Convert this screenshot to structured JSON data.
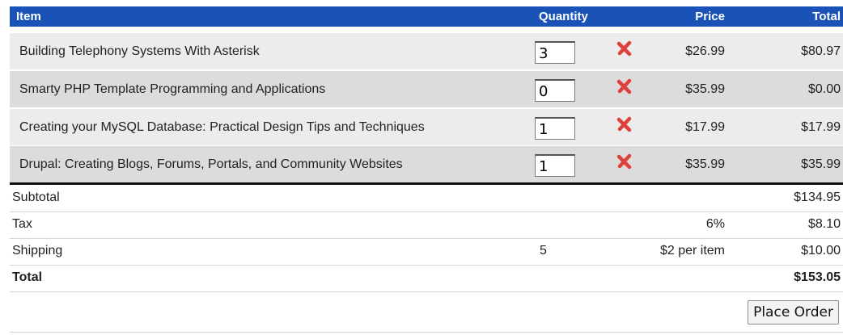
{
  "header": {
    "item": "Item",
    "quantity": "Quantity",
    "price": "Price",
    "total": "Total"
  },
  "colors": {
    "header_bg": "#1a52b8",
    "remove_icon": "#e0403a"
  },
  "items": [
    {
      "title": "Building Telephony Systems With Asterisk",
      "qty": "3",
      "price": "$26.99",
      "total": "$80.97"
    },
    {
      "title": "Smarty PHP Template Programming and Applications",
      "qty": "0",
      "price": "$35.99",
      "total": "$0.00"
    },
    {
      "title": "Creating your MySQL Database: Practical Design Tips and Techniques",
      "qty": "1",
      "price": "$17.99",
      "total": "$17.99"
    },
    {
      "title": "Drupal: Creating Blogs, Forums, Portals, and Community Websites",
      "qty": "1",
      "price": "$35.99",
      "total": "$35.99"
    }
  ],
  "summary": {
    "subtotal": {
      "label": "Subtotal",
      "total": "$134.95"
    },
    "tax": {
      "label": "Tax",
      "rate": "6%",
      "total": "$8.10"
    },
    "shipping": {
      "label": "Shipping",
      "count": "5",
      "rate": "$2 per item",
      "total": "$10.00"
    },
    "grand": {
      "label": "Total",
      "total": "$153.05"
    }
  },
  "actions": {
    "place_order": "Place Order"
  },
  "icons": {
    "remove": "x-icon"
  }
}
